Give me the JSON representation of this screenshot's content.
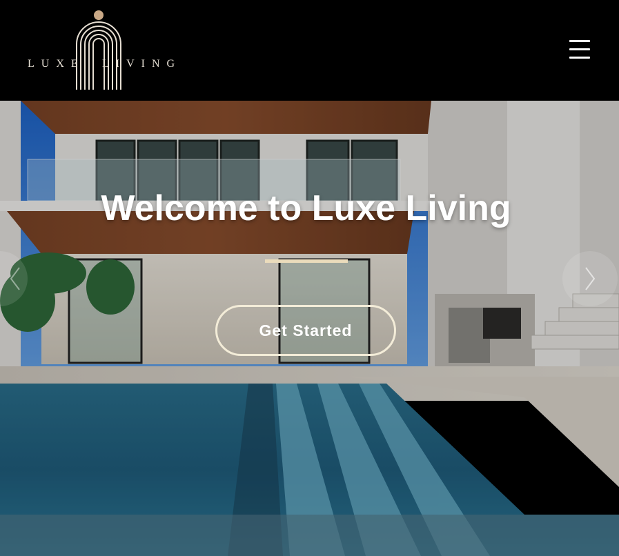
{
  "brand": {
    "logo_word1": "LUXE",
    "logo_word2": "LIVING",
    "accent_color": "#c9a987"
  },
  "header": {
    "menu_icon": "hamburger-menu-icon"
  },
  "hero": {
    "title": "Welcome to Luxe Living",
    "cta_label": "Get Started",
    "prev_icon": "chevron-left-icon",
    "next_icon": "chevron-right-icon",
    "divider_color": "#ebdcbc"
  }
}
